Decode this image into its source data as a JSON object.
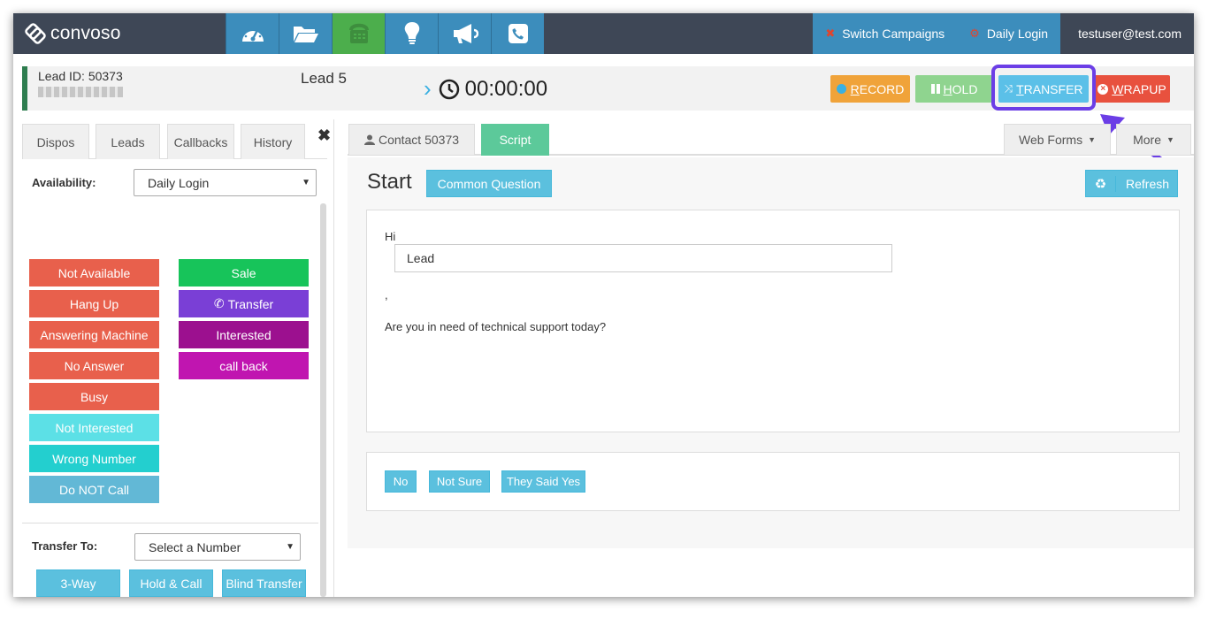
{
  "app": {
    "name": "convoso",
    "nav_icons": [
      {
        "name": "dashboard-icon"
      },
      {
        "name": "folder-icon"
      },
      {
        "name": "phone-desk-icon"
      },
      {
        "name": "lightbulb-icon"
      },
      {
        "name": "megaphone-icon"
      },
      {
        "name": "phone-icon"
      }
    ],
    "switch_campaigns": "Switch Campaigns",
    "daily_login": "Daily Login",
    "user": "testuser@test.com"
  },
  "lead": {
    "id_label": "Lead ID: 50373",
    "name": "Lead 5",
    "timer": "00:00:00"
  },
  "call_buttons": {
    "record_first": "R",
    "record_rest": "ECORD",
    "hold_first": "H",
    "hold_rest": "OLD",
    "transfer_first": "T",
    "transfer_rest": "RANSFER",
    "wrapup_first": "W",
    "wrapup_rest": "RAPUP"
  },
  "colors": {
    "record": "#f0a33a",
    "hold": "#8fd48f",
    "transfer": "#5bc0e8",
    "wrapup": "#e8513e",
    "highlight": "#6b3ee6"
  },
  "left_panel": {
    "tabs": [
      "Dispos",
      "Leads",
      "Callbacks",
      "History"
    ],
    "availability_label": "Availability:",
    "availability_value": "Daily Login",
    "dispositions_left": [
      {
        "label": "Not Available",
        "color": "#e8604c"
      },
      {
        "label": "Hang Up",
        "color": "#e8604c"
      },
      {
        "label": "Answering Machine",
        "color": "#e8604c"
      },
      {
        "label": "No Answer",
        "color": "#e8604c"
      },
      {
        "label": "Busy",
        "color": "#e8604c"
      },
      {
        "label": "Not Interested",
        "color": "#5ce0e6"
      },
      {
        "label": "Wrong Number",
        "color": "#23cfcf"
      },
      {
        "label": "Do NOT Call",
        "color": "#62b8d6"
      }
    ],
    "dispositions_right": [
      {
        "label": "Sale",
        "color": "#17c45a"
      },
      {
        "label": "Transfer",
        "color": "#7a3fd6"
      },
      {
        "label": "Interested",
        "color": "#9c108f"
      },
      {
        "label": "call back",
        "color": "#c015b0"
      }
    ],
    "transfer_to_label": "Transfer To:",
    "transfer_select": "Select a Number",
    "transfer_buttons": [
      "3-Way",
      "Hold & Call",
      "Blind Transfer"
    ]
  },
  "main_panel": {
    "tabs": {
      "contact": "Contact 50373",
      "script": "Script",
      "web_forms": "Web Forms",
      "more": "More"
    },
    "start": "Start",
    "common_question": "Common Question",
    "refresh": "Refresh",
    "script": {
      "greeting": "Hi",
      "lead_value": "Lead",
      "comma": ",",
      "question": "Are you in need of technical support today?"
    },
    "answers": [
      "No",
      "Not Sure",
      "They Said Yes"
    ]
  }
}
